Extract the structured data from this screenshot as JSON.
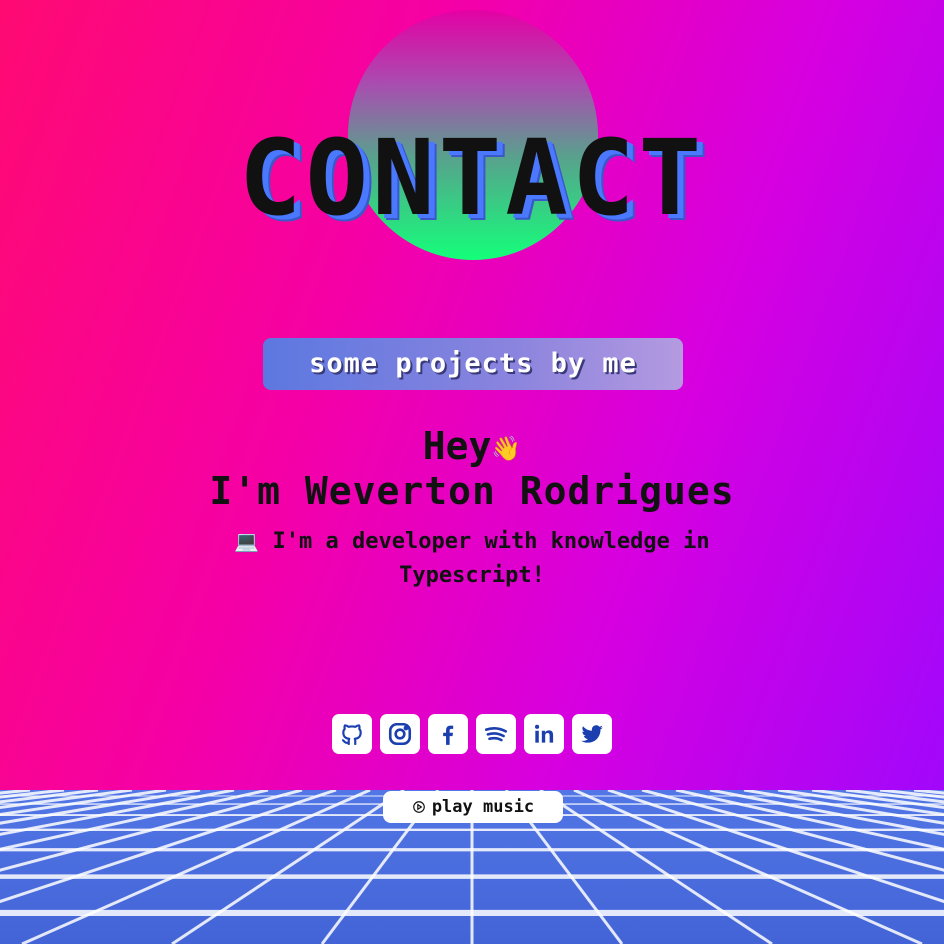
{
  "hero": {
    "title": "CONTACT"
  },
  "projects_button": {
    "label": "some projects by me"
  },
  "intro": {
    "greeting": "Hey",
    "greeting_emoji": "👋",
    "name": "I'm Weverton Rodrigues",
    "laptop_emoji": "💻",
    "description": "I'm a developer with knowledge in Typescript!"
  },
  "socials": [
    {
      "icon": "github-icon"
    },
    {
      "icon": "instagram-icon"
    },
    {
      "icon": "facebook-icon"
    },
    {
      "icon": "spotify-icon"
    },
    {
      "icon": "linkedin-icon"
    },
    {
      "icon": "twitter-icon"
    }
  ],
  "music": {
    "label": "play music",
    "icon": "play-circle-icon"
  },
  "colors": {
    "background_start": "#ff0a72",
    "background_end": "#9a08ff",
    "sun_top": "#e400a4",
    "sun_bottom": "#14ff7a",
    "title_shadow": "#4a78ff",
    "grid_floor": "#4b6fdc",
    "grid_lines": "#ffffff"
  }
}
